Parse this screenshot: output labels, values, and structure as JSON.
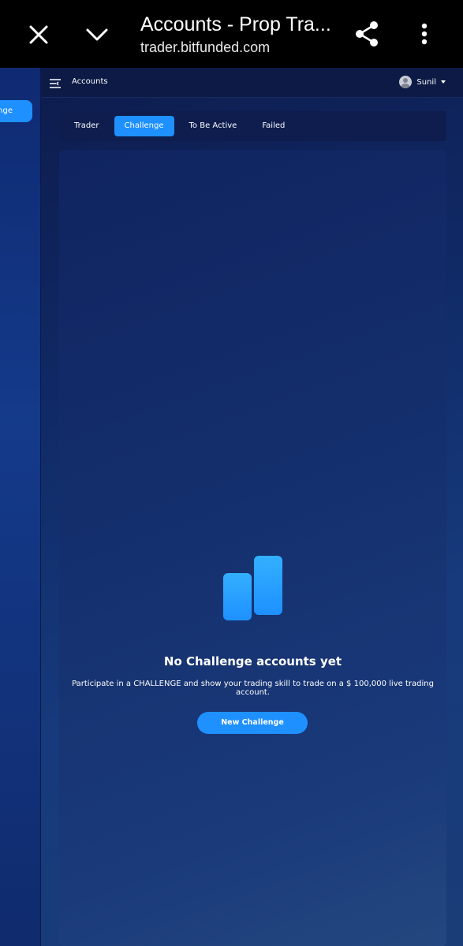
{
  "browser": {
    "title": "Accounts - Prop Tra...",
    "url": "trader.bitfunded.com"
  },
  "sidebar": {
    "active_item_label": "nge"
  },
  "topnav": {
    "title": "Accounts",
    "user_name": "Sunil"
  },
  "tabs": [
    {
      "label": "Trader",
      "active": false
    },
    {
      "label": "Challenge",
      "active": true
    },
    {
      "label": "To Be Active",
      "active": false
    },
    {
      "label": "Failed",
      "active": false
    }
  ],
  "empty_state": {
    "title": "No Challenge accounts yet",
    "description": "Participate in a CHALLENGE and show your trading skill to trade on a $ 100,000 live trading account.",
    "button_label": "New Challenge"
  },
  "colors": {
    "accent": "#1e90ff",
    "background": "#102a66"
  }
}
